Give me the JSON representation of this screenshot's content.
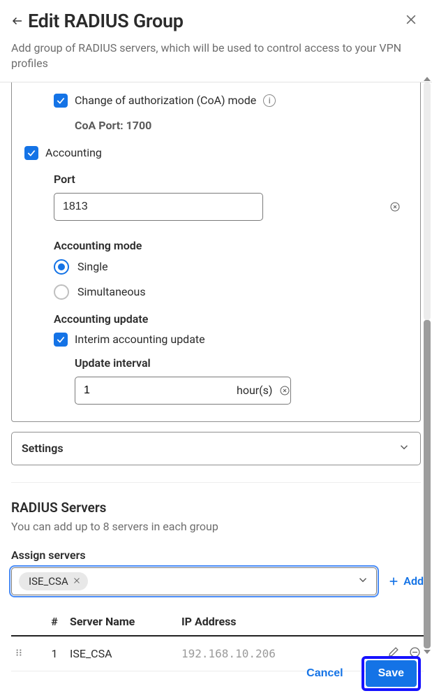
{
  "header": {
    "title": "Edit RADIUS Group",
    "subtitle": "Add group of RADIUS servers, which will be used to control access to your VPN profiles"
  },
  "coa": {
    "checkbox_label": "Change of authorization (CoA) mode",
    "port_label": "CoA Port: 1700"
  },
  "accounting": {
    "checkbox_label": "Accounting",
    "port_label": "Port",
    "port_value": "1813",
    "mode_label": "Accounting mode",
    "mode_single": "Single",
    "mode_simultaneous": "Simultaneous",
    "update_heading": "Accounting update",
    "interim_label": "Interim accounting update",
    "interval_label": "Update interval",
    "interval_value": "1",
    "interval_unit": "hour(s)"
  },
  "settings": {
    "label": "Settings"
  },
  "servers": {
    "heading": "RADIUS Servers",
    "description": "You can add up to 8 servers in each group",
    "assign_label": "Assign servers",
    "chip_value": "ISE_CSA",
    "add_label": "Add",
    "cols": {
      "idx": "#",
      "name": "Server Name",
      "ip": "IP Address"
    },
    "rows": [
      {
        "idx": "1",
        "name": "ISE_CSA",
        "ip": "192.168.10.206"
      }
    ]
  },
  "footer": {
    "cancel": "Cancel",
    "save": "Save"
  }
}
